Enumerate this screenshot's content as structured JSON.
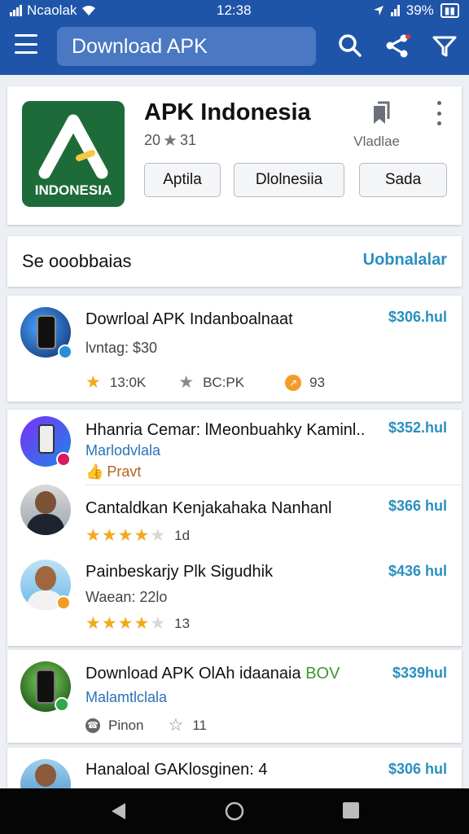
{
  "status_bar": {
    "carrier": "Ncaolak",
    "time": "12:38",
    "battery": "39%"
  },
  "app_bar": {
    "search_text": "Download APK",
    "icons": [
      "menu-icon",
      "search-icon",
      "share-icon",
      "filter-icon"
    ]
  },
  "app": {
    "logo_text": "INDONESIA",
    "title": "APK Indonesia",
    "rating": "20",
    "rating_count": "31",
    "side_label": "Vladlae",
    "buttons": [
      "Aptila",
      "Dlolnesiia",
      "Sada"
    ]
  },
  "section": {
    "title": "Se ooobbaias",
    "link": "Uobnalalar"
  },
  "items": [
    {
      "title": "Dowrloal APK Indanboalnaat",
      "subtitle": "lvntag: $30",
      "price": "$306.hul",
      "meta": [
        "13:0K",
        "BC:PK",
        "93"
      ]
    },
    {
      "title": "Hhanria Cemar: lMeonbuahky Kaminl..",
      "subtitle": "Marlodvlala",
      "tag": "Pravt",
      "price": "$352.hul"
    },
    {
      "title": "Cantaldkan Kenjakahaka Nanhanl",
      "rating_value": 4.5,
      "rating_label": "1d",
      "price": "$366 hul"
    },
    {
      "title": "Painbeskarjy Plk Sigudhik",
      "subtitle": "Waean: 22lo",
      "rating_value": 4.5,
      "rating_label": "13",
      "price": "$436 hul"
    },
    {
      "title": "Download APK OlAh idaanaia",
      "title_badge": "BOV",
      "subtitle": "Malamtlclala",
      "meta": [
        "Pinon",
        "11"
      ],
      "price": "$339hul"
    },
    {
      "title": "Hanaloal GAKlosginen:",
      "title_suffix": "4",
      "price": "$306 hul"
    }
  ],
  "colors": {
    "app_bar": "#1f55a8",
    "accent_price": "#2a8fc0",
    "star": "#f2a91c",
    "logo_bg": "#1e6b3a"
  }
}
